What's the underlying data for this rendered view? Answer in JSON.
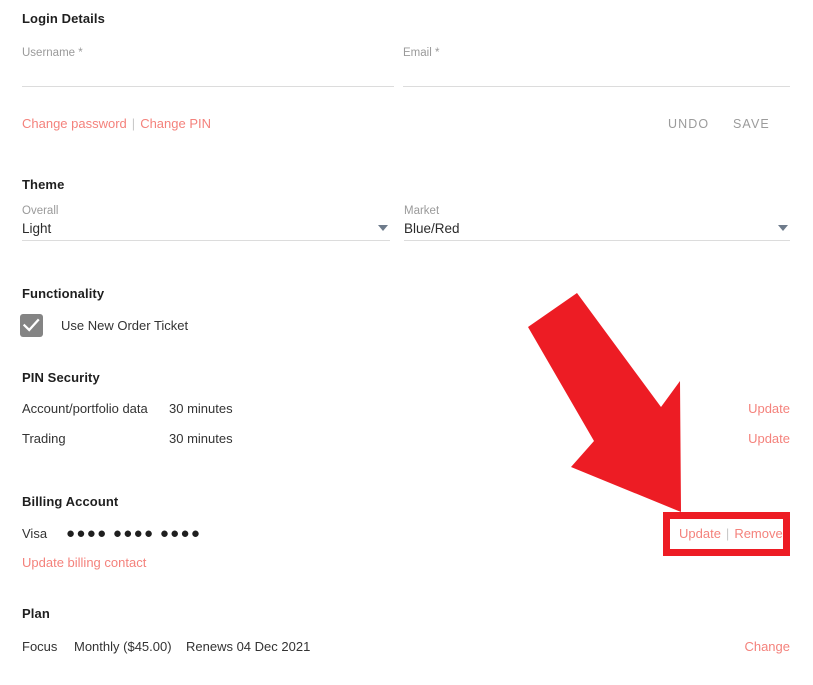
{
  "colors": {
    "link": "#f4827c",
    "annotation_red": "#ed1c24",
    "muted": "#9a9a9a",
    "text": "#2b2b2b",
    "underline": "#dcdcdc",
    "checkbox_fill": "#848484"
  },
  "login": {
    "title": "Login Details",
    "username": {
      "label": "Username *",
      "value": "",
      "placeholder": ""
    },
    "email": {
      "label": "Email *",
      "value": "",
      "placeholder": ""
    },
    "change_password_link": "Change password",
    "separator": "|",
    "change_pin_link": "Change PIN",
    "undo_button": "UNDO",
    "save_button": "SAVE"
  },
  "theme": {
    "title": "Theme",
    "overall": {
      "label": "Overall",
      "value": "Light"
    },
    "market": {
      "label": "Market",
      "value": "Blue/Red"
    }
  },
  "functionality": {
    "title": "Functionality",
    "checkbox_label": "Use New Order Ticket",
    "checkbox_checked": "checked"
  },
  "pin_security": {
    "title": "PIN Security",
    "rows": [
      {
        "name": "Account/portfolio data",
        "duration": "30 minutes",
        "action": "Update"
      },
      {
        "name": "Trading",
        "duration": "30 minutes",
        "action": "Update"
      }
    ]
  },
  "billing": {
    "title": "Billing Account",
    "card_type": "Visa",
    "card_mask": "●●●● ●●●● ●●●●",
    "update_link": "Update",
    "separator": "|",
    "remove_link": "Remove",
    "update_billing_contact_link": "Update billing contact"
  },
  "plan": {
    "title": "Plan",
    "name": "Focus",
    "billing_cycle": "Monthly ($45.00)",
    "renewal": "Renews 04 Dec 2021",
    "change_link": "Change"
  },
  "annotation": {
    "arrow_name": "red-arrow-pointing-to-update-remove",
    "highlight_name": "red-highlight-box-around-update-remove"
  }
}
